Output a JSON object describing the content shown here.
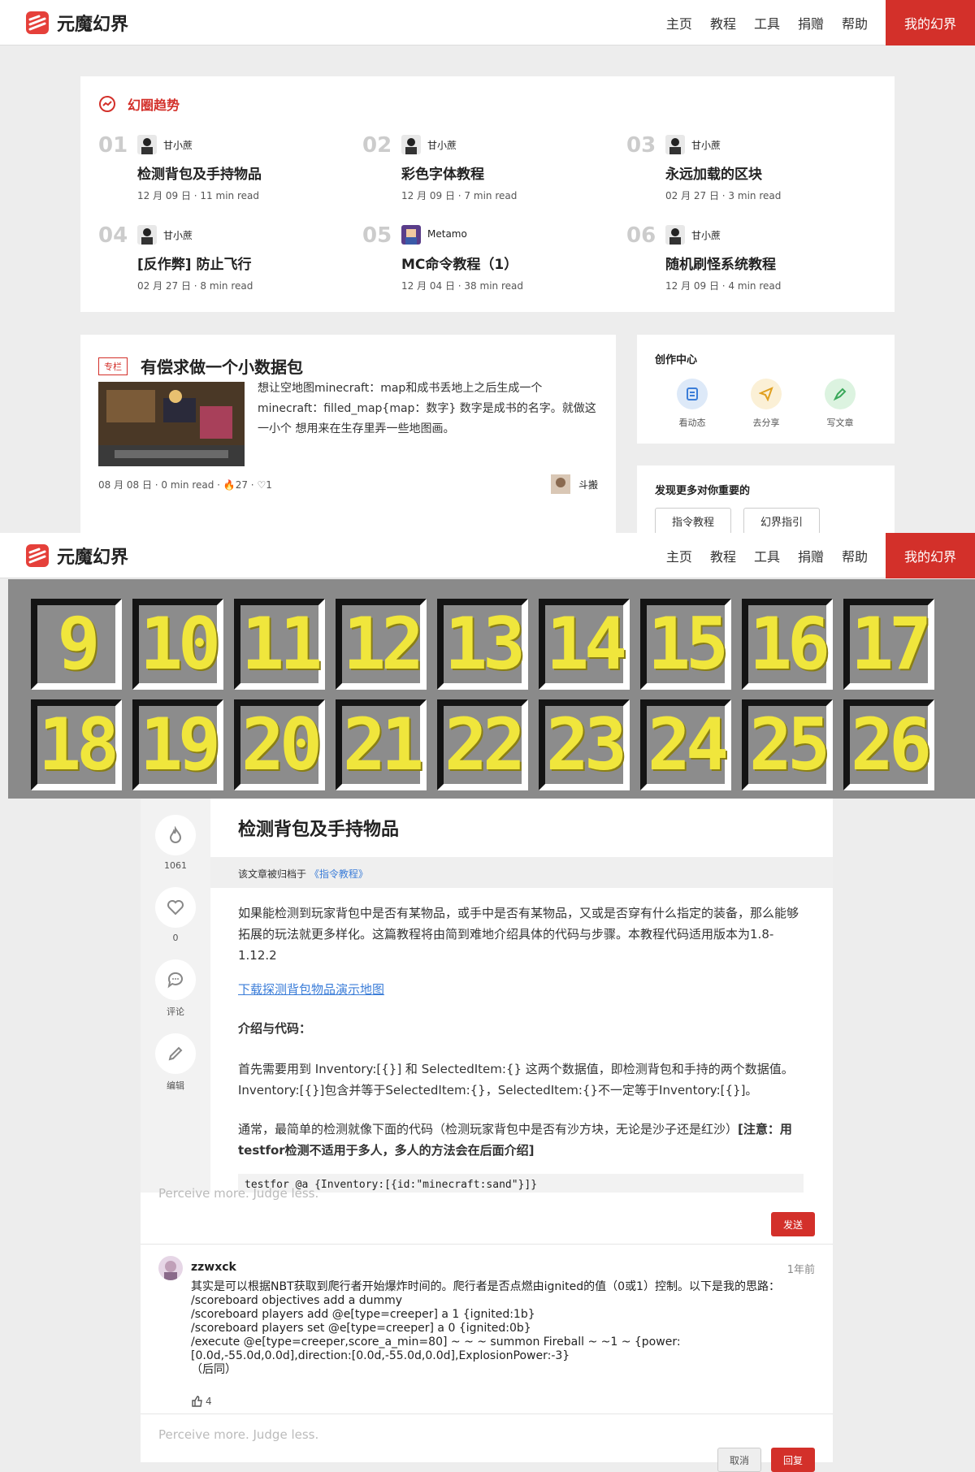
{
  "brand": {
    "name": "元魔幻界"
  },
  "nav": {
    "items": [
      "主页",
      "教程",
      "工具",
      "捐赠",
      "帮助"
    ],
    "my": "我的幻界"
  },
  "trend": {
    "title": "幻圈趋势",
    "items": [
      {
        "num": "01",
        "author": "甘小蔗",
        "title": "检测背包及手持物品",
        "meta": "12 月 09 日 · 11 min read"
      },
      {
        "num": "02",
        "author": "甘小蔗",
        "title": "彩色字体教程",
        "meta": "12 月 09 日 · 7 min read"
      },
      {
        "num": "03",
        "author": "甘小蔗",
        "title": "永远加载的区块",
        "meta": "02 月 27 日 · 3 min read"
      },
      {
        "num": "04",
        "author": "甘小蔗",
        "title": "[反作弊] 防止飞行",
        "meta": "02 月 27 日 · 8 min read"
      },
      {
        "num": "05",
        "author": "Metamo",
        "title": "MC命令教程（1）",
        "meta": "12 月 04 日 · 38 min read"
      },
      {
        "num": "06",
        "author": "甘小蔗",
        "title": "随机刷怪系统教程",
        "meta": "12 月 09 日 · 4 min read"
      }
    ]
  },
  "post": {
    "tag": "专栏",
    "title": "有偿求做一个小数据包",
    "desc": "想让空地图minecraft：map和成书丢地上之后生成一个minecraft：filled_map{map：数字} 数字是成书的名字。就做这一小个 想用来在生存里弄一些地图画。",
    "meta": "08 月 08 日 · 0 min read · 🔥27 · ♡1",
    "author": "斗搬"
  },
  "creation": {
    "title": "创作中心",
    "actions": [
      "看动态",
      "去分享",
      "写文章"
    ]
  },
  "discover": {
    "title": "发现更多对你重要的",
    "chips": [
      "指令教程",
      "幻界指引"
    ]
  },
  "banner": {
    "numbers": [
      "9",
      "10",
      "11",
      "12",
      "13",
      "14",
      "15",
      "16",
      "17",
      "18",
      "19",
      "20",
      "21",
      "22",
      "23",
      "24",
      "25",
      "26"
    ]
  },
  "rail": {
    "views": "1061",
    "likes": "0",
    "comment": "评论",
    "edit": "编辑"
  },
  "article": {
    "title": "检测背包及手持物品",
    "archived_prefix": "该文章被归档于",
    "archived_link": "《指令教程》",
    "p1": "如果能检测到玩家背包中是否有某物品，或手中是否有某物品，又或是否穿有什么指定的装备，那么能够拓展的玩法就更多样化。这篇教程将由简到难地介绍具体的代码与步骤。本教程代码适用版本为1.8-1.12.2",
    "link": "下载探测背包物品演示地图",
    "h": "介绍与代码：",
    "p2": "首先需要用到 Inventory:[{}] 和 SelectedItem:{} 这两个数据值，即检测背包和手持的两个数据值。Inventory:[{}]包含并等于SelectedItem:{}，SelectedItem:{}不一定等于Inventory:[{}]。",
    "p3a": "通常，最简单的检测就像下面的代码（检测玩家背包中是否有沙方块，无论是沙子还是红沙）",
    "p3b": "[注意：用testfor检测不适用于多人，多人的方法会在后面介绍]",
    "code": "testfor @a {Inventory:[{id:\"minecraft:sand\"}]}"
  },
  "comment": {
    "placeholder": "Perceive more. Judge less.",
    "send": "发送",
    "user": "zzwxck",
    "time": "1年前",
    "lines": [
      "其实是可以根据NBT获取到爬行者开始爆炸时间的。爬行者是否点燃由ignited的值（0或1）控制。以下是我的思路：",
      "/scoreboard objectives add a dummy",
      "/scoreboard players add @e[type=creeper] a 1 {ignited:1b}",
      "/scoreboard players set @e[type=creeper] a 0 {ignited:0b}",
      "/execute @e[type=creeper,score_a_min=80] ~ ~ ~ summon Fireball ~ ~1 ~ {power:[0.0d,-55.0d,0.0d],direction:[0.0d,-55.0d,0.0d],ExplosionPower:-3}",
      "（后同）"
    ],
    "likes": "4",
    "reply_placeholder": "Perceive more. Judge less.",
    "cancel": "取消",
    "reply": "回复"
  },
  "colors": {
    "accent": "#d3302a",
    "link": "#3b7dd8",
    "banner_digit": "#f0e63c"
  }
}
